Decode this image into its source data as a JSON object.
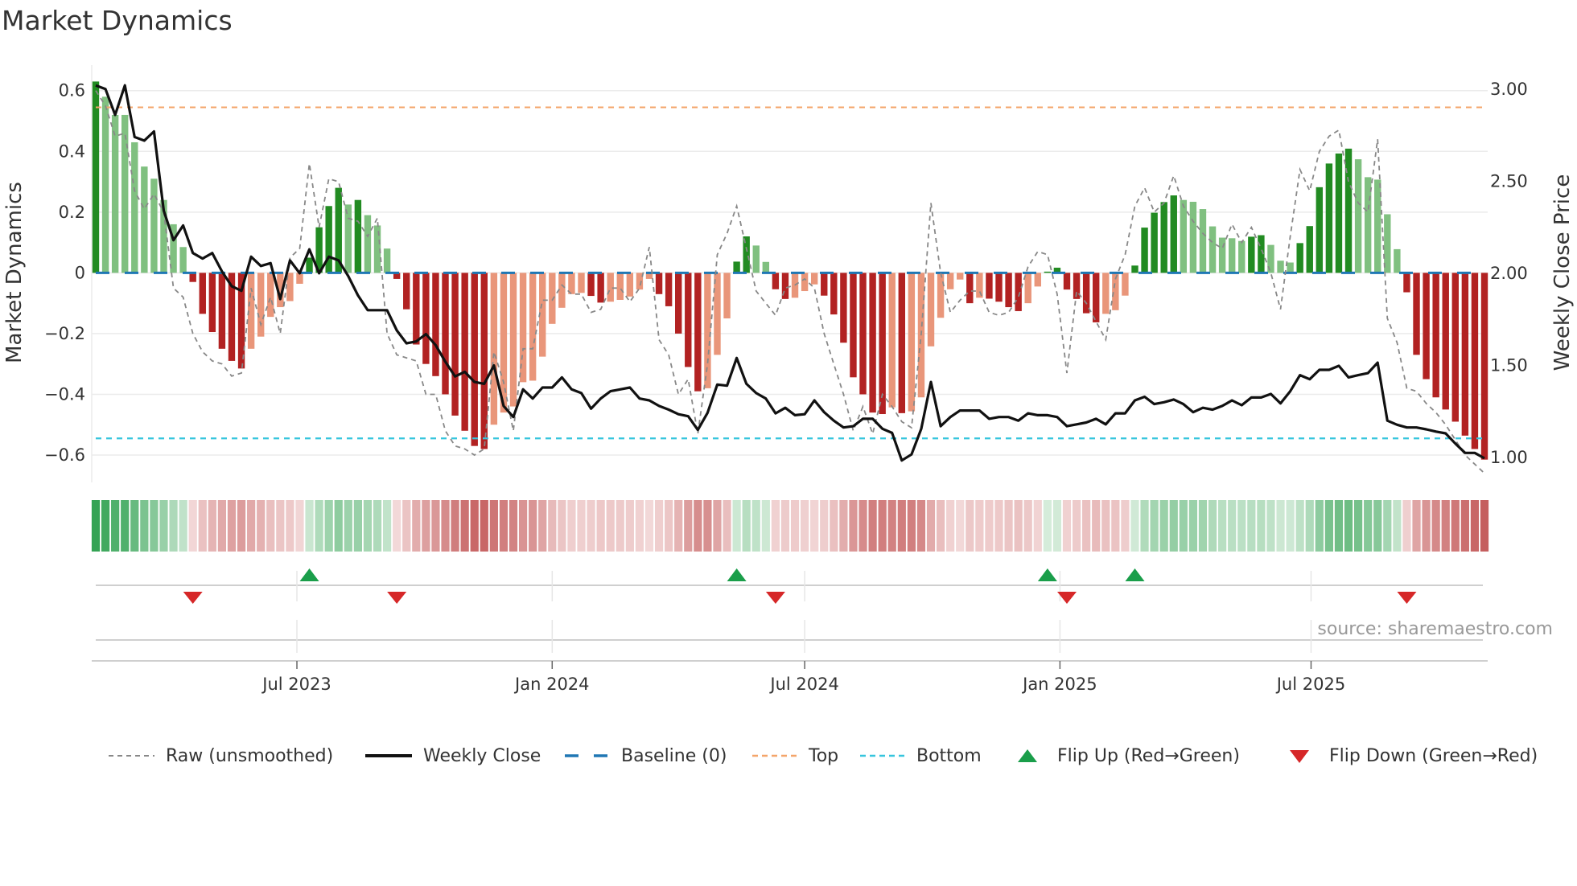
{
  "title": "Market Dynamics",
  "source": "source: sharemaestro.com",
  "legend": {
    "raw": "Raw (unsmoothed)",
    "close": "Weekly Close",
    "baseline": "Baseline (0)",
    "top": "Top",
    "bottom": "Bottom",
    "flip_up": "Flip Up (Red→Green)",
    "flip_down": "Flip Down (Green→Red)"
  },
  "colors": {
    "up_strong": "#228b22",
    "up_weak": "#80c080",
    "down_strong": "#b22222",
    "down_weak": "#e9967a",
    "close": "#111111",
    "raw": "#888888",
    "baseline": "#1f77b4",
    "top": "#f4a56a",
    "bottom": "#36c5dd",
    "flip_up": "#1a9e4a",
    "flip_down": "#d62728"
  },
  "chart_data": {
    "type": "bar",
    "title": "Market Dynamics",
    "ylabel": "Market Dynamics",
    "ylabel_right": "Weekly Close Price",
    "xlabel": "",
    "start_date": "2023-02-06",
    "interval_days": 7,
    "ylim": [
      -0.69,
      0.684
    ],
    "ylim_right": [
      0.865,
      3.13
    ],
    "y_ticks": [
      0.6,
      0.4,
      0.2,
      0,
      -0.2,
      -0.4,
      -0.6
    ],
    "y_tick_labels": [
      "0.6",
      "0.4",
      "0.2",
      "0",
      "−0.2",
      "−0.4",
      "−0.6"
    ],
    "y_right_ticks": [
      3.0,
      2.5,
      2.0,
      1.5,
      1.0
    ],
    "y_right_tick_labels": [
      "3.00",
      "2.50",
      "2.00",
      "1.50",
      "1.00"
    ],
    "x_ticks": [
      {
        "date": "2023-07-01",
        "label": "Jul 2023"
      },
      {
        "date": "2024-01-01",
        "label": "Jan 2024"
      },
      {
        "date": "2024-07-01",
        "label": "Jul 2024"
      },
      {
        "date": "2025-01-01",
        "label": "Jan 2025"
      },
      {
        "date": "2025-07-01",
        "label": "Jul 2025"
      }
    ],
    "baseline": 0,
    "top": 0.545,
    "bottom": -0.545,
    "grid": true,
    "legend_position": "bottom",
    "series": [
      {
        "name": "Market Dynamics (smoothed)",
        "values": [
          0.63,
          0.58,
          0.52,
          0.52,
          0.43,
          0.35,
          0.31,
          0.24,
          0.16,
          0.085,
          -0.03,
          -0.135,
          -0.195,
          -0.25,
          -0.29,
          -0.315,
          -0.25,
          -0.21,
          -0.145,
          -0.113,
          -0.093,
          -0.036,
          0.05,
          0.15,
          0.22,
          0.28,
          0.225,
          0.24,
          0.19,
          0.156,
          0.08,
          -0.02,
          -0.12,
          -0.236,
          -0.3,
          -0.34,
          -0.4,
          -0.47,
          -0.52,
          -0.57,
          -0.58,
          -0.5,
          -0.46,
          -0.44,
          -0.36,
          -0.355,
          -0.276,
          -0.168,
          -0.115,
          -0.07,
          -0.066,
          -0.076,
          -0.098,
          -0.095,
          -0.089,
          -0.078,
          -0.055,
          -0.02,
          -0.07,
          -0.11,
          -0.2,
          -0.31,
          -0.39,
          -0.38,
          -0.27,
          -0.15,
          0.037,
          0.12,
          0.09,
          0.036,
          -0.054,
          -0.086,
          -0.082,
          -0.06,
          -0.038,
          -0.075,
          -0.137,
          -0.23,
          -0.344,
          -0.4,
          -0.46,
          -0.465,
          -0.443,
          -0.462,
          -0.456,
          -0.41,
          -0.242,
          -0.148,
          -0.054,
          -0.022,
          -0.1,
          -0.082,
          -0.085,
          -0.095,
          -0.113,
          -0.126,
          -0.1,
          -0.045,
          0.004,
          0.017,
          -0.055,
          -0.086,
          -0.133,
          -0.163,
          -0.135,
          -0.123,
          -0.075,
          0.024,
          0.149,
          0.198,
          0.233,
          0.255,
          0.24,
          0.234,
          0.21,
          0.153,
          0.116,
          0.114,
          0.105,
          0.119,
          0.124,
          0.092,
          0.04,
          0.034,
          0.098,
          0.154,
          0.282,
          0.36,
          0.393,
          0.409,
          0.374,
          0.315,
          0.307,
          0.193,
          0.078,
          -0.064,
          -0.27,
          -0.35,
          -0.41,
          -0.45,
          -0.49,
          -0.536,
          -0.58,
          -0.615
        ]
      },
      {
        "name": "Raw (unsmoothed)",
        "values": [
          0.6,
          0.55,
          0.45,
          0.46,
          0.27,
          0.21,
          0.26,
          0.2,
          -0.05,
          -0.08,
          -0.2,
          -0.26,
          -0.29,
          -0.3,
          -0.34,
          -0.33,
          -0.05,
          -0.17,
          -0.08,
          -0.2,
          0.05,
          0.08,
          0.36,
          0.15,
          0.31,
          0.3,
          0.18,
          0.17,
          0.12,
          0.18,
          -0.2,
          -0.27,
          -0.28,
          -0.29,
          -0.4,
          -0.4,
          -0.52,
          -0.57,
          -0.58,
          -0.6,
          -0.58,
          -0.26,
          -0.36,
          -0.52,
          -0.25,
          -0.25,
          -0.09,
          -0.09,
          -0.04,
          -0.07,
          -0.07,
          -0.13,
          -0.12,
          -0.05,
          -0.05,
          -0.095,
          -0.05,
          0.085,
          -0.22,
          -0.27,
          -0.4,
          -0.35,
          -0.53,
          -0.3,
          0.06,
          0.13,
          0.22,
          0.08,
          -0.06,
          -0.1,
          -0.14,
          -0.05,
          -0.04,
          -0.02,
          -0.05,
          -0.2,
          -0.3,
          -0.4,
          -0.52,
          -0.44,
          -0.53,
          -0.4,
          -0.44,
          -0.49,
          -0.51,
          -0.2,
          0.23,
          0.0,
          -0.13,
          -0.09,
          -0.06,
          -0.06,
          -0.13,
          -0.14,
          -0.13,
          -0.08,
          0.02,
          0.07,
          0.06,
          -0.07,
          -0.33,
          -0.06,
          -0.1,
          -0.16,
          -0.22,
          -0.02,
          0.06,
          0.22,
          0.28,
          0.2,
          0.23,
          0.32,
          0.22,
          0.17,
          0.13,
          0.1,
          0.08,
          0.16,
          0.1,
          0.15,
          0.08,
          0.0,
          -0.12,
          0.12,
          0.34,
          0.27,
          0.4,
          0.45,
          0.47,
          0.3,
          0.23,
          0.2,
          0.44,
          -0.15,
          -0.23,
          -0.38,
          -0.39,
          -0.43,
          -0.46,
          -0.5,
          -0.55,
          -0.6,
          -0.63,
          -0.66
        ]
      },
      {
        "name": "Weekly Close",
        "axis": "right",
        "values": [
          3.02,
          3.0,
          2.86,
          3.02,
          2.74,
          2.72,
          2.77,
          2.34,
          2.18,
          2.26,
          2.11,
          2.08,
          2.11,
          2.01,
          1.93,
          1.905,
          2.09,
          2.04,
          2.055,
          1.86,
          2.07,
          2.0,
          2.13,
          2.0,
          2.09,
          2.07,
          1.985,
          1.88,
          1.8,
          1.8,
          1.8,
          1.69,
          1.62,
          1.63,
          1.67,
          1.61,
          1.52,
          1.44,
          1.465,
          1.41,
          1.4,
          1.5,
          1.28,
          1.22,
          1.37,
          1.32,
          1.38,
          1.38,
          1.435,
          1.37,
          1.35,
          1.265,
          1.32,
          1.36,
          1.37,
          1.38,
          1.32,
          1.31,
          1.28,
          1.26,
          1.235,
          1.224,
          1.15,
          1.243,
          1.396,
          1.39,
          1.54,
          1.4,
          1.35,
          1.32,
          1.24,
          1.27,
          1.23,
          1.235,
          1.31,
          1.246,
          1.2,
          1.163,
          1.17,
          1.21,
          1.21,
          1.156,
          1.134,
          0.984,
          1.017,
          1.156,
          1.41,
          1.17,
          1.22,
          1.255,
          1.255,
          1.255,
          1.21,
          1.22,
          1.22,
          1.2,
          1.24,
          1.23,
          1.23,
          1.22,
          1.17,
          1.18,
          1.19,
          1.21,
          1.18,
          1.24,
          1.24,
          1.31,
          1.33,
          1.29,
          1.3,
          1.315,
          1.29,
          1.246,
          1.27,
          1.26,
          1.28,
          1.31,
          1.284,
          1.326,
          1.326,
          1.345,
          1.294,
          1.36,
          1.447,
          1.425,
          1.476,
          1.476,
          1.498,
          1.435,
          1.447,
          1.458,
          1.515,
          1.2,
          1.178,
          1.163,
          1.163,
          1.153,
          1.141,
          1.131,
          1.076,
          1.025,
          1.025,
          0.996
        ]
      }
    ]
  }
}
